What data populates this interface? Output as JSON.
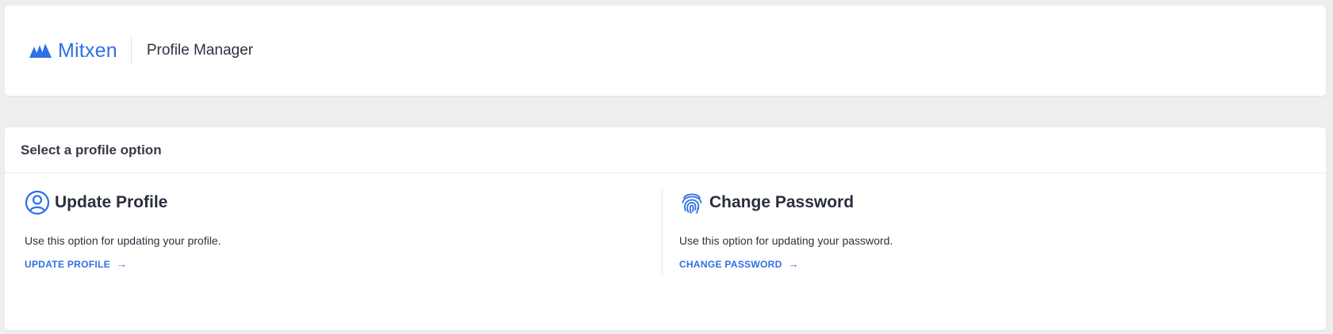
{
  "header": {
    "brand_name": "Mitxen",
    "app_title": "Profile Manager",
    "brand_color": "#2f6fe6"
  },
  "card": {
    "title": "Select a profile option",
    "options": [
      {
        "icon": "user-circle-icon",
        "title": "Update Profile",
        "description": "Use this option for updating your profile.",
        "link_label": "UPDATE PROFILE"
      },
      {
        "icon": "fingerprint-icon",
        "title": "Change Password",
        "description": "Use this option for updating your password.",
        "link_label": "CHANGE PASSWORD"
      }
    ]
  }
}
